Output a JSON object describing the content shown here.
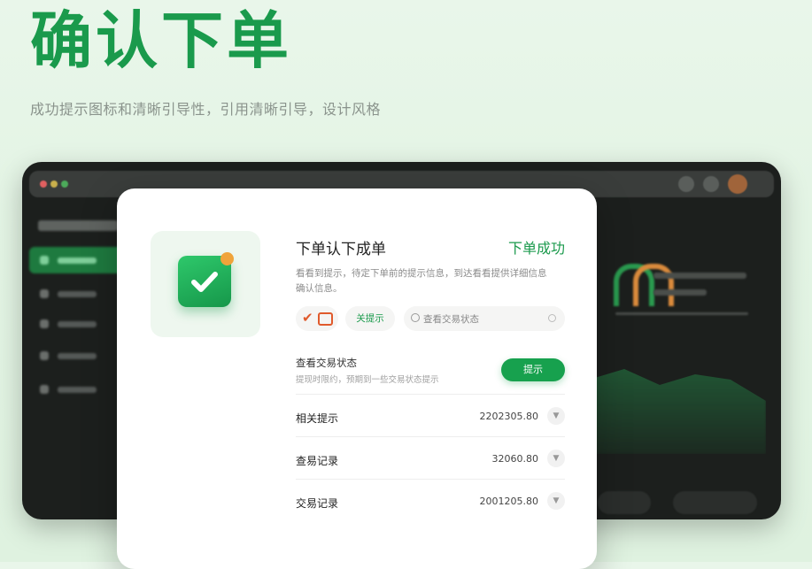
{
  "hero": {
    "title": "确认下单",
    "subtitle": "成功提示图标和清晰引导性，引用清晰引导，设计风格"
  },
  "dialog": {
    "title": "下单认下成单",
    "status": "下单成功",
    "description": "看看到提示，待定下单前的提示信息，到达看看提供详细信息确认信息。",
    "chip_label": "关提示",
    "search_placeholder": "查看交易状态",
    "query_title": "查看交易状态",
    "query_sub": "提现时限约，预期到一些交易状态提示",
    "submit_label": "提示",
    "rows": [
      {
        "label": "相关提示",
        "value": "2202305.80"
      },
      {
        "label": "查易记录",
        "value": "32060.80"
      },
      {
        "label": "交易记录",
        "value": "2001205.80"
      }
    ]
  },
  "colors": {
    "accent": "#1a9a4c",
    "warning": "#f0a33a",
    "chip_icon": "#e05a2c"
  },
  "icons": {
    "main": "check-icon",
    "chip": [
      "check-mark-icon",
      "wallet-icon"
    ],
    "search": "search-icon",
    "row_action": "chevron-down-icon"
  }
}
